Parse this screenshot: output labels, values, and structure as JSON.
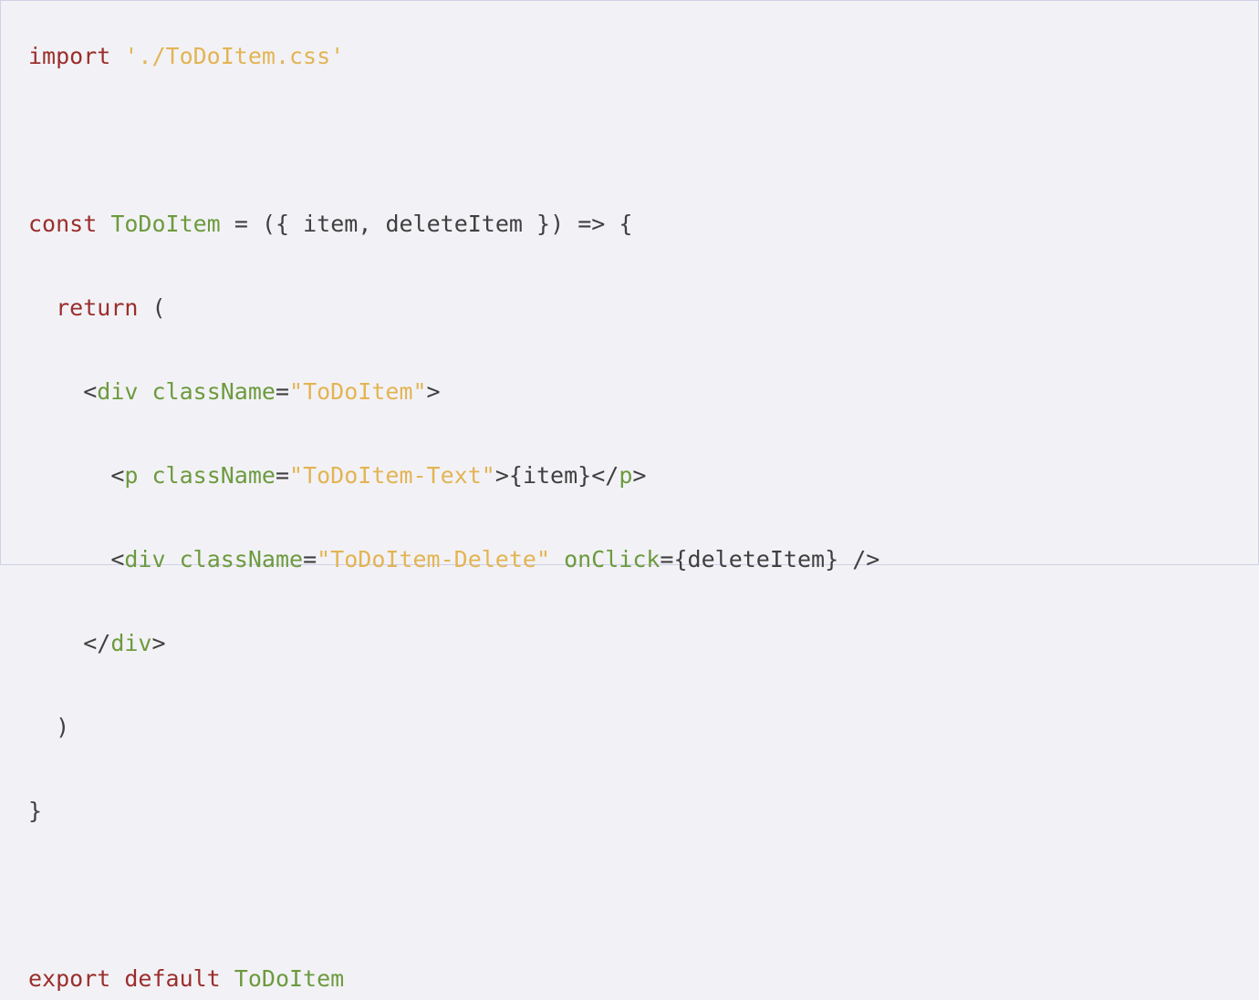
{
  "code": {
    "line1": {
      "kw_import": "import",
      "str_css": "'./ToDoItem.css'"
    },
    "line3": {
      "kw_const": "const",
      "ident_component": "ToDoItem",
      "eq": "=",
      "open": "({",
      "param_item": "item",
      "comma": ",",
      "param_delete": "deleteItem",
      "close": "})",
      "arrow": "=>",
      "brace_open": "{"
    },
    "line4": {
      "kw_return": "return",
      "paren_open": "("
    },
    "line5": {
      "lt": "<",
      "tag_div": "div",
      "attr_className": "className",
      "eq": "=",
      "val": "\"ToDoItem\"",
      "gt": ">"
    },
    "line6": {
      "lt": "<",
      "tag_p": "p",
      "attr_className": "className",
      "eq": "=",
      "val": "\"ToDoItem-Text\"",
      "gt": ">",
      "expr_open": "{",
      "expr_item": "item",
      "expr_close": "}",
      "close_lt": "</",
      "close_tag": "p",
      "close_gt": ">"
    },
    "line7": {
      "lt": "<",
      "tag_div": "div",
      "attr_className": "className",
      "eq": "=",
      "val": "\"ToDoItem-Delete\"",
      "attr_onClick": "onClick",
      "eq2": "=",
      "expr_open": "{",
      "expr_delete": "deleteItem",
      "expr_close": "}",
      "selfclose": "/>"
    },
    "line8": {
      "close_lt": "</",
      "close_tag": "div",
      "close_gt": ">"
    },
    "line9": {
      "paren_close": ")"
    },
    "line10": {
      "brace_close": "}"
    },
    "line12": {
      "kw_export": "export",
      "kw_default": "default",
      "ident_component": "ToDoItem"
    }
  },
  "colors": {
    "background": "#f2f2f6",
    "keyword": "#9b2e2c",
    "string": "#e3b454",
    "identifier": "#6d9a3e",
    "punctuation": "#3f3f3f"
  }
}
